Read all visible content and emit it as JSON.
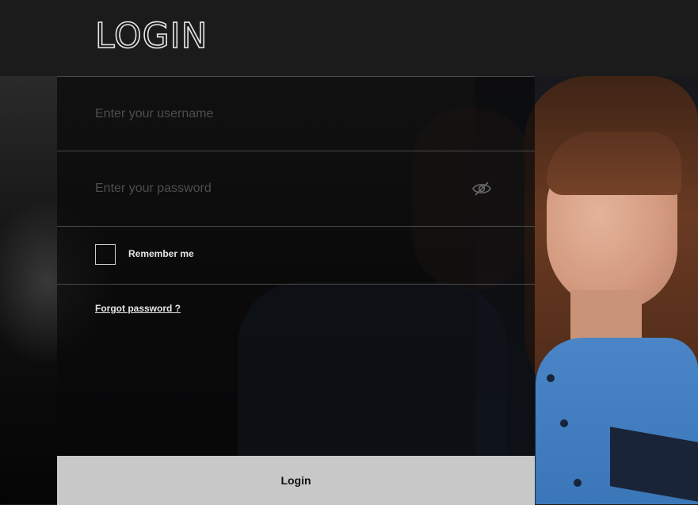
{
  "header": {
    "title": "LOGIN"
  },
  "form": {
    "username": {
      "value": "",
      "placeholder": "Enter your username"
    },
    "password": {
      "value": "",
      "placeholder": "Enter your password",
      "toggle_icon": "eye-slash-icon"
    },
    "remember_me": {
      "label": "Remember me",
      "checked": false
    },
    "forgot_password": {
      "label": "Forgot password ?"
    },
    "submit": {
      "label": "Login"
    }
  },
  "colors": {
    "header_bg": "#1b1b1b",
    "panel_bg": "#08080a",
    "button_bg": "#c8c8c8",
    "text": "#e5e5e5"
  }
}
